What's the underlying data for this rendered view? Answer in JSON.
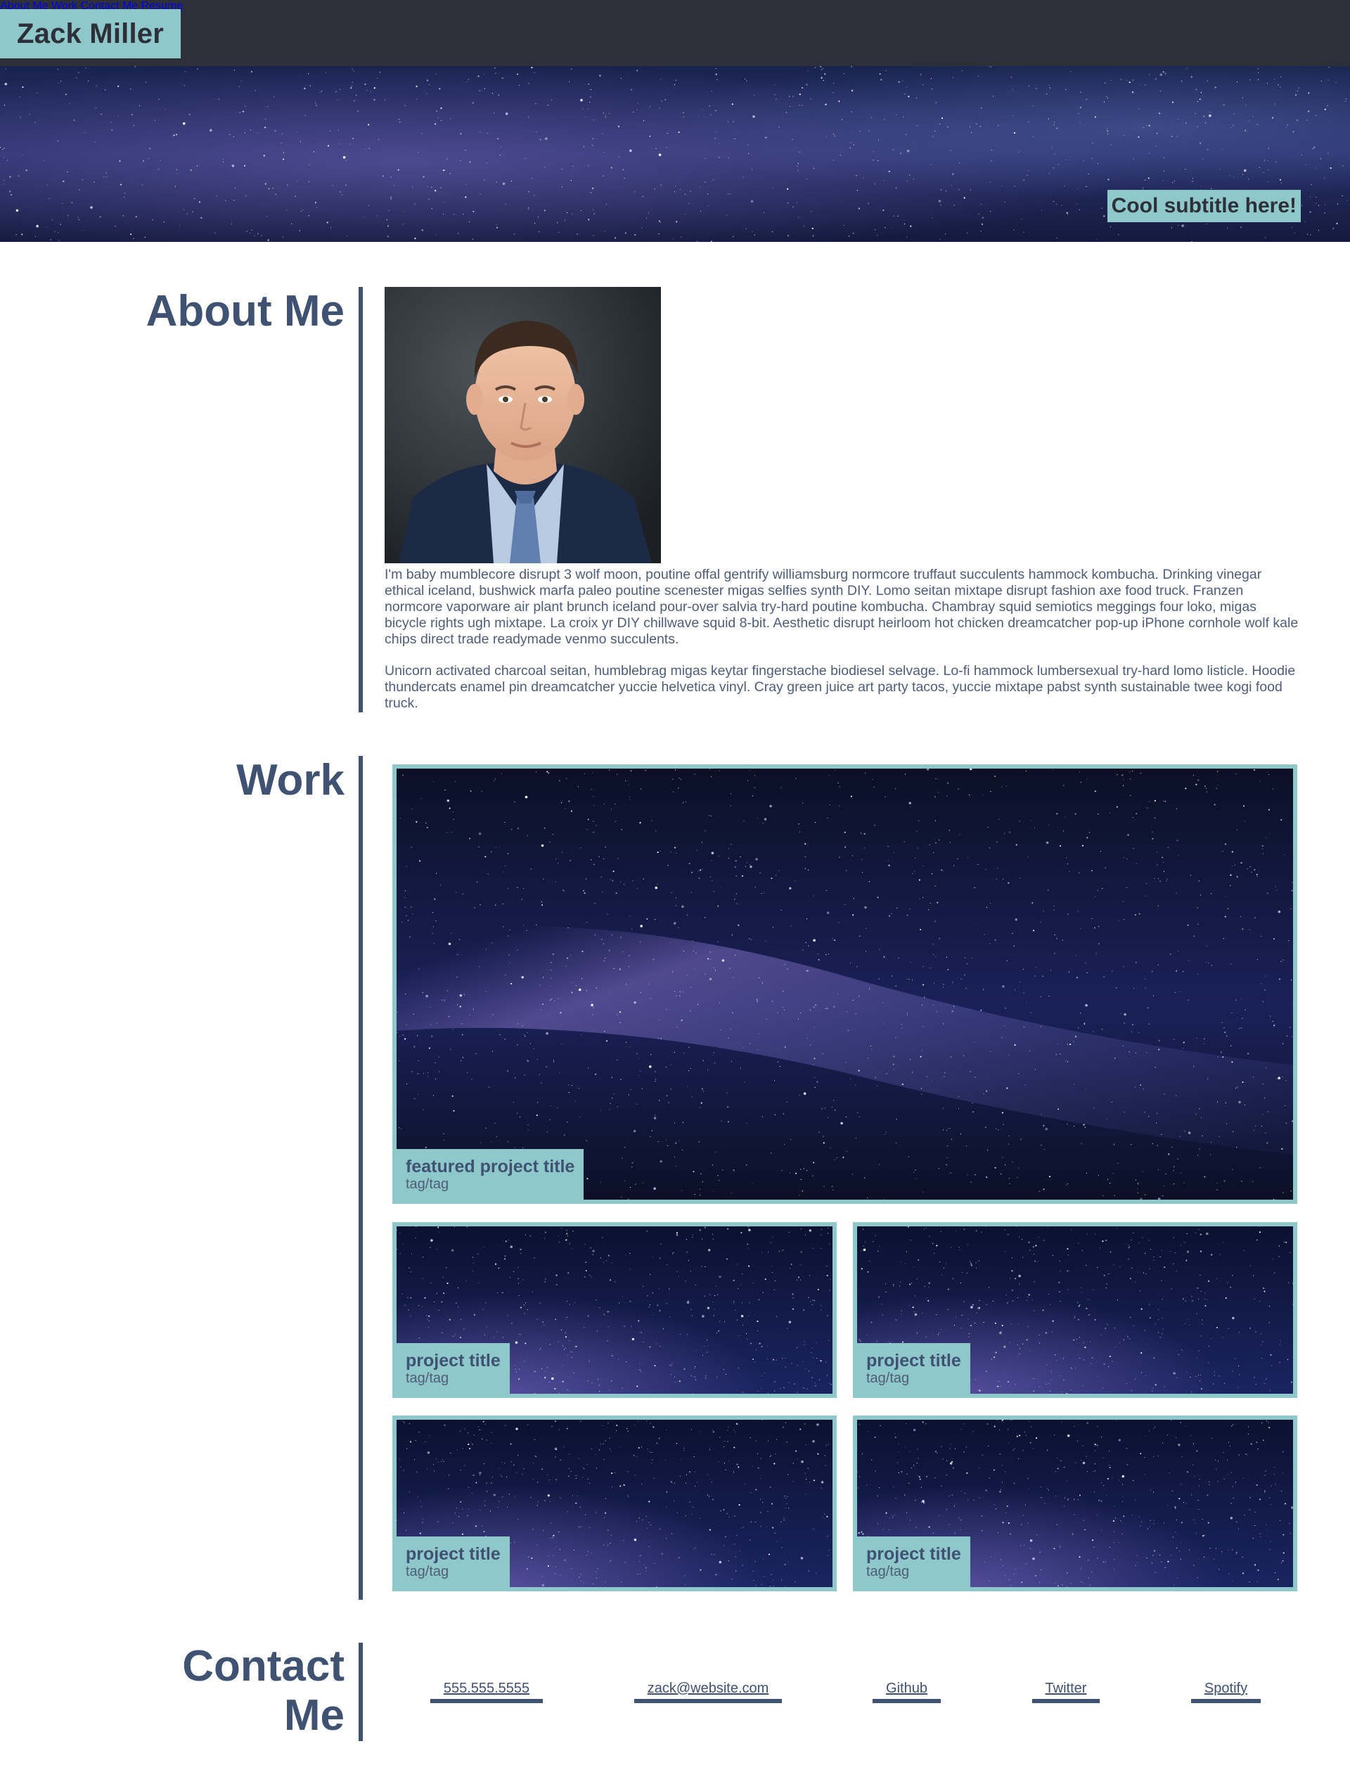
{
  "header": {
    "brand": "Zack Miller",
    "nav": [
      {
        "label": "About Me"
      },
      {
        "label": "Work"
      },
      {
        "label": "Contact Me"
      },
      {
        "label": "Resume"
      }
    ]
  },
  "hero": {
    "subtitle": "Cool subtitle here!"
  },
  "about": {
    "title": "About Me",
    "paragraphs": [
      "I'm baby mumblecore disrupt 3 wolf moon, poutine offal gentrify williamsburg normcore truffaut succulents hammock kombucha. Drinking vinegar ethical iceland, bushwick marfa paleo poutine scenester migas selfies synth DIY. Lomo seitan mixtape disrupt fashion axe food truck. Franzen normcore vaporware air plant brunch iceland pour-over salvia try-hard poutine kombucha. Chambray squid semiotics meggings four loko, migas bicycle rights ugh mixtape. La croix yr DIY chillwave squid 8-bit. Aesthetic disrupt heirloom hot chicken dreamcatcher pop-up iPhone cornhole wolf kale chips direct trade readymade venmo succulents.",
      "Unicorn activated charcoal seitan, humblebrag migas keytar fingerstache biodiesel selvage. Lo-fi hammock lumbersexual try-hard lomo listicle. Hoodie thundercats enamel pin dreamcatcher yuccie helvetica vinyl. Cray green juice art party tacos, yuccie mixtape pabst synth sustainable twee kogi food truck."
    ]
  },
  "work": {
    "title": "Work",
    "featured": {
      "title": "featured project title",
      "tag": "tag/tag"
    },
    "projects": [
      {
        "title": "project title",
        "tag": "tag/tag"
      },
      {
        "title": "project title",
        "tag": "tag/tag"
      },
      {
        "title": "project title",
        "tag": "tag/tag"
      },
      {
        "title": "project title",
        "tag": "tag/tag"
      }
    ]
  },
  "contact": {
    "title_line1": "Contact",
    "title_line2": "Me",
    "links": [
      {
        "label": "555.555.5555"
      },
      {
        "label": "zack@website.com"
      },
      {
        "label": "Github"
      },
      {
        "label": "Twitter"
      },
      {
        "label": "Spotify"
      }
    ]
  },
  "colors": {
    "header_bg": "#2d3039",
    "accent": "#8fc8ca",
    "text": "#3f5272"
  }
}
